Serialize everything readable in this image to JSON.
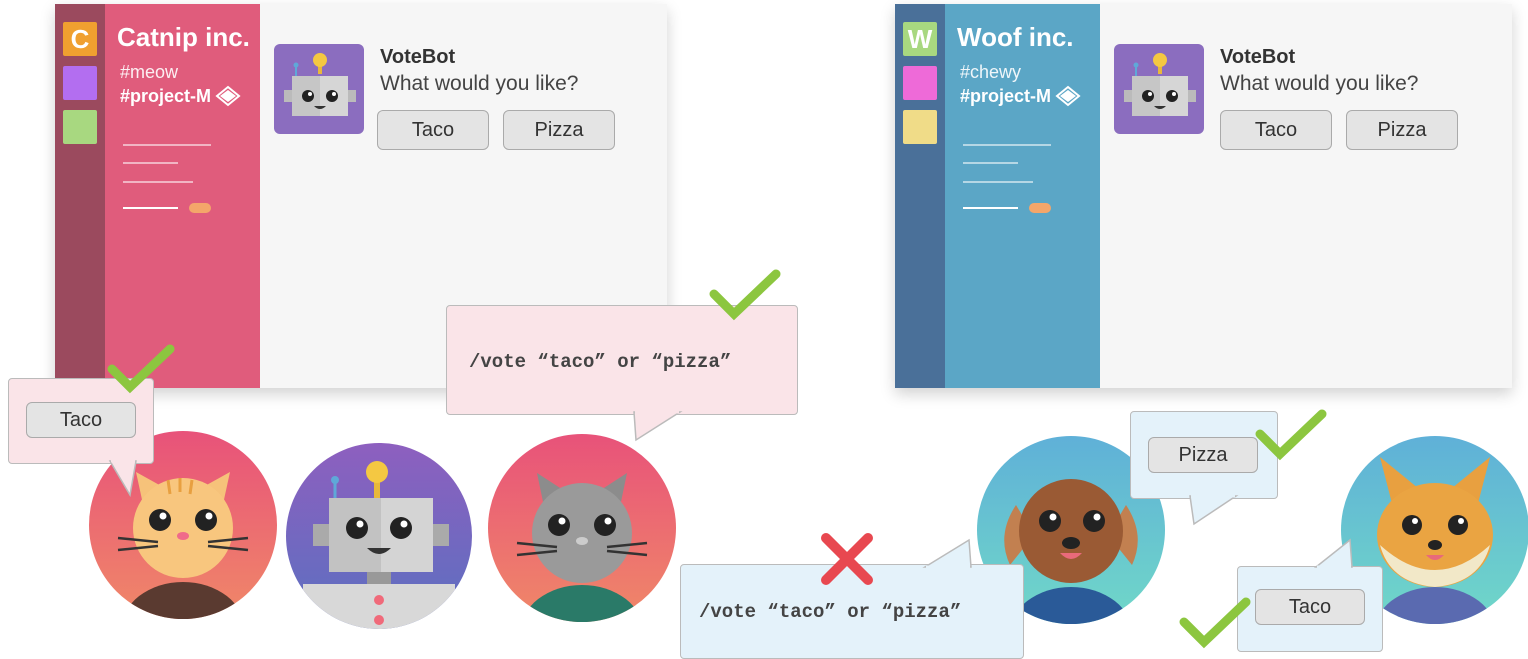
{
  "left_workspace": {
    "initial": "C",
    "name": "Catnip inc.",
    "channel": "#meow",
    "active_channel": "#project-M",
    "colors": {
      "rail": "#9b4a5e",
      "sidebar": "#e05c7c",
      "tile1": "#f0a030",
      "tile2": "#b36ef0",
      "tile3": "#a8d880"
    }
  },
  "right_workspace": {
    "initial": "W",
    "name": "Woof inc.",
    "channel": "#chewy",
    "active_channel": "#project-M",
    "colors": {
      "rail": "#4a7099",
      "sidebar": "#5ba6c6",
      "tile1": "#a8d880",
      "tile2": "#ee6ad8",
      "tile3": "#f0dc88"
    }
  },
  "bot": {
    "name": "VoteBot",
    "message": "What would you like?",
    "options": [
      "Taco",
      "Pizza"
    ]
  },
  "left_command": "/vote “taco” or “pizza”",
  "right_command": "/vote “taco” or “pizza”",
  "cat_vote": "Taco",
  "dog_vote": "Pizza",
  "fox_vote": "Taco",
  "icons": {
    "check": "check-icon",
    "cross": "cross-icon"
  },
  "status_colors": {
    "check": "#8cc63f",
    "cross": "#e84850"
  }
}
